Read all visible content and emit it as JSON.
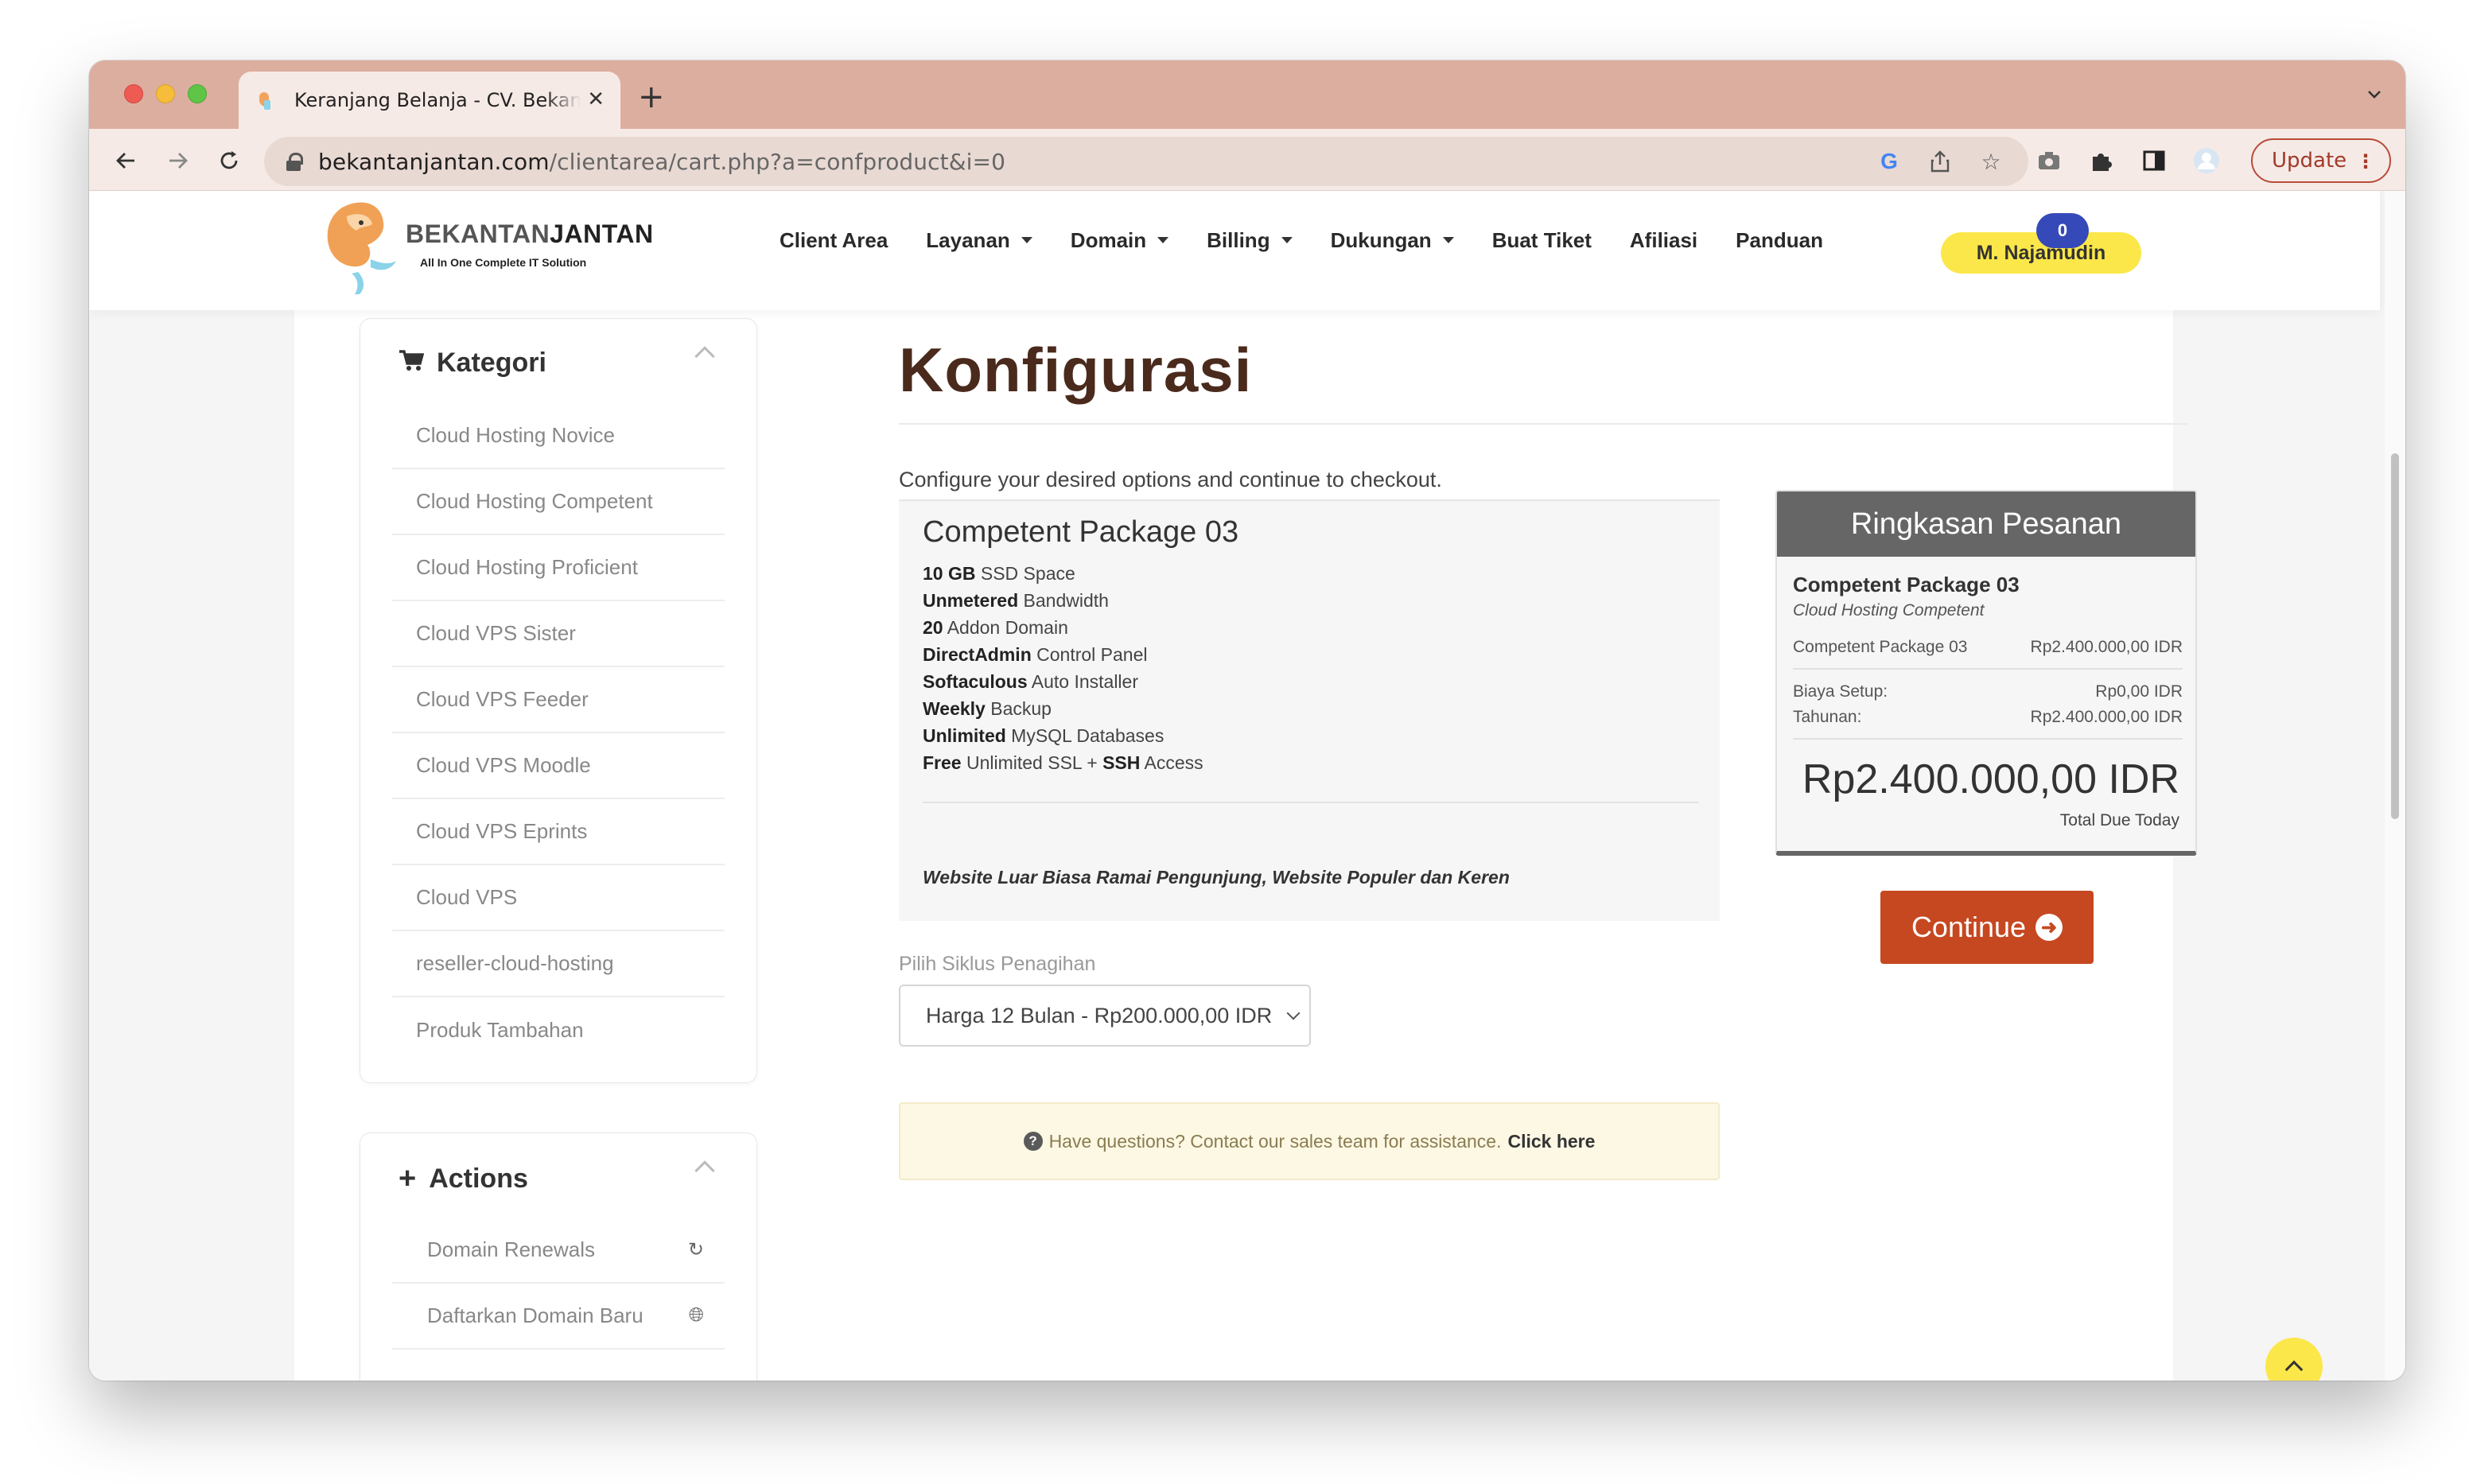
{
  "browser": {
    "tab_title": "Keranjang Belanja - CV. Bekantan Jantan",
    "url_host": "bekantanjantan.com",
    "url_path": "/clientarea/cart.php?a=confproduct&i=0",
    "update_label": "Update"
  },
  "site": {
    "brand_left": "BEKANTAN",
    "brand_right": "JANTAN",
    "tagline": "All In One Complete IT Solution",
    "nav": [
      {
        "label": "Client Area",
        "dropdown": false
      },
      {
        "label": "Layanan",
        "dropdown": true
      },
      {
        "label": "Domain",
        "dropdown": true
      },
      {
        "label": "Billing",
        "dropdown": true
      },
      {
        "label": "Dukungan",
        "dropdown": true
      },
      {
        "label": "Buat Tiket",
        "dropdown": false
      },
      {
        "label": "Afiliasi",
        "dropdown": false
      },
      {
        "label": "Panduan",
        "dropdown": false
      }
    ],
    "user_name": "M. Najamudin",
    "cart_count": "0"
  },
  "sidebar": {
    "categories_title": "Kategori",
    "categories": [
      "Cloud Hosting Novice",
      "Cloud Hosting Competent",
      "Cloud Hosting Proficient",
      "Cloud VPS Sister",
      "Cloud VPS Feeder",
      "Cloud VPS Moodle",
      "Cloud VPS Eprints",
      "Cloud VPS",
      "reseller-cloud-hosting",
      "Produk Tambahan"
    ],
    "actions_title": "Actions",
    "actions": [
      "Domain Renewals",
      "Daftarkan Domain Baru"
    ]
  },
  "main": {
    "title": "Konfigurasi",
    "intro": "Configure your desired options and continue to checkout.",
    "package_name": "Competent Package 03",
    "features": [
      {
        "bold": "10 GB",
        "text": " SSD Space"
      },
      {
        "bold": "Unmetered",
        "text": " Bandwidth"
      },
      {
        "bold": "20",
        "text": " Addon Domain"
      },
      {
        "bold": "DirectAdmin",
        "text": " Control Panel"
      },
      {
        "bold": "Softaculous",
        "text": " Auto Installer"
      },
      {
        "bold": "Weekly",
        "text": " Backup"
      },
      {
        "bold": "Unlimited",
        "text": " MySQL Databases"
      },
      {
        "bold": "Free",
        "text": " Unlimited SSL + ",
        "bold2": "SSH",
        "text2": " Access"
      }
    ],
    "package_tagline": "Website Luar Biasa Ramai Pengunjung, Website Populer dan Keren",
    "billing_cycle_label": "Pilih Siklus Penagihan",
    "billing_cycle_value": "Harga 12 Bulan - Rp200.000,00 IDR",
    "help_text": "Have questions? Contact our sales team for assistance.",
    "help_link": "Click here"
  },
  "summary": {
    "title": "Ringkasan Pesanan",
    "product": "Competent Package 03",
    "group": "Cloud Hosting Competent",
    "line_label": "Competent Package 03",
    "line_price": "Rp2.400.000,00 IDR",
    "setup_label": "Biaya Setup:",
    "setup_value": "Rp0,00 IDR",
    "annual_label": "Tahunan:",
    "annual_value": "Rp2.400.000,00 IDR",
    "total": "Rp2.400.000,00 IDR",
    "total_caption": "Total Due Today",
    "continue_label": "Continue"
  },
  "colors": {
    "tab_strip": "#dcaea0",
    "brand_yellow": "#fbe74a",
    "continue_button": "#c64820",
    "title_brown": "#4a2a1c",
    "badge_blue": "#3649b8"
  }
}
